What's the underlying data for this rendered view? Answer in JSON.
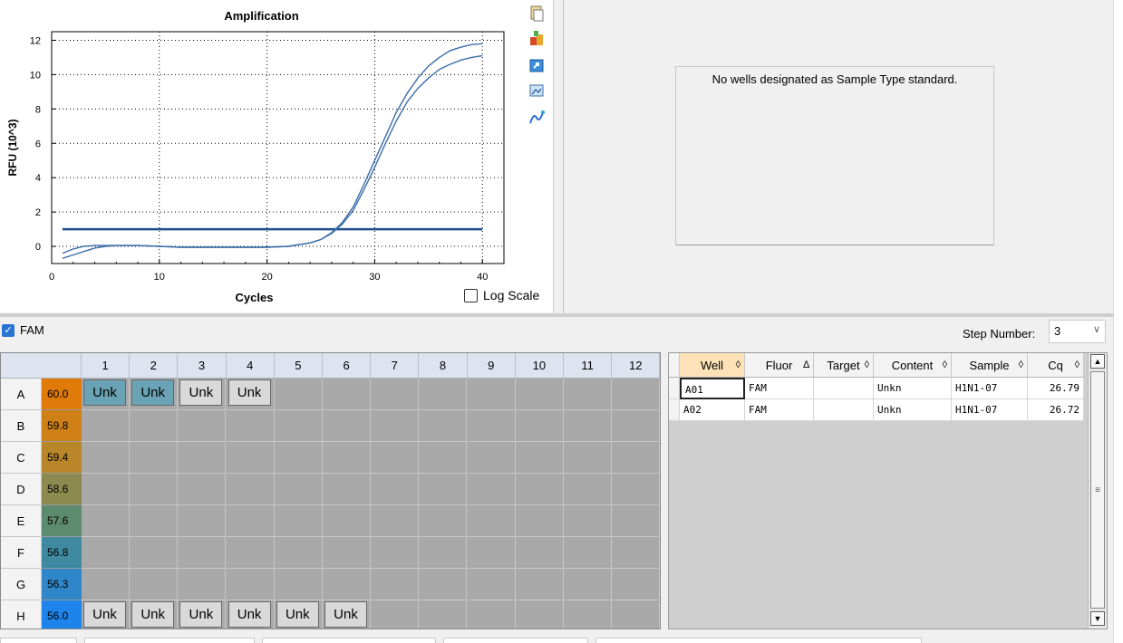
{
  "chart_data": {
    "type": "line",
    "title": "Amplification",
    "xlabel": "Cycles",
    "ylabel": "RFU (10^3)",
    "xlim": [
      0,
      42
    ],
    "ylim": [
      -1,
      12.5
    ],
    "xticks": [
      0,
      10,
      20,
      30,
      40
    ],
    "yticks": [
      0,
      2,
      4,
      6,
      8,
      10,
      12
    ],
    "grid": true,
    "threshold": 1.0,
    "series": [
      {
        "color": "#3d6ea8",
        "x": [
          1,
          2,
          3,
          4,
          5,
          6,
          8,
          10,
          12,
          14,
          16,
          18,
          20,
          22,
          23,
          24,
          25,
          26,
          27,
          28,
          29,
          30,
          31,
          32,
          33,
          34,
          35,
          36,
          37,
          38,
          39,
          40
        ],
        "y": [
          -0.7,
          -0.5,
          -0.3,
          -0.1,
          0,
          0.05,
          0.05,
          0,
          -0.05,
          -0.05,
          -0.05,
          -0.05,
          -0.05,
          0,
          0.1,
          0.2,
          0.4,
          0.8,
          1.4,
          2.3,
          3.6,
          5.0,
          6.4,
          7.8,
          8.9,
          9.8,
          10.5,
          11.0,
          11.4,
          11.6,
          11.75,
          11.8
        ]
      },
      {
        "color": "#3d6ea8",
        "x": [
          1,
          2,
          3,
          4,
          5,
          6,
          8,
          10,
          12,
          14,
          16,
          18,
          20,
          22,
          23,
          24,
          25,
          26,
          27,
          28,
          29,
          30,
          31,
          32,
          33,
          34,
          35,
          36,
          37,
          38,
          39,
          40
        ],
        "y": [
          -0.4,
          -0.15,
          0,
          0.05,
          0.05,
          0.05,
          0.05,
          0,
          -0.05,
          -0.05,
          -0.05,
          -0.05,
          -0.05,
          0,
          0.1,
          0.2,
          0.4,
          0.75,
          1.3,
          2.1,
          3.3,
          4.6,
          6.0,
          7.3,
          8.4,
          9.2,
          9.8,
          10.3,
          10.6,
          10.85,
          11.0,
          11.1
        ]
      }
    ]
  },
  "log_scale_label": "Log Scale",
  "tools": [
    "copy-icon",
    "export-icon",
    "refresh-icon",
    "image-icon",
    "line-settings-icon"
  ],
  "std_message": "No wells designated as Sample Type standard.",
  "fluor_label": "FAM",
  "step_label": "Step Number:",
  "step_value": "3",
  "plate": {
    "cols": [
      "1",
      "2",
      "3",
      "4",
      "5",
      "6",
      "7",
      "8",
      "9",
      "10",
      "11",
      "12"
    ],
    "rows": [
      "A",
      "B",
      "C",
      "D",
      "E",
      "F",
      "G",
      "H"
    ],
    "temps": [
      "60.0",
      "59.8",
      "59.4",
      "58.6",
      "57.6",
      "56.8",
      "56.3",
      "56.0"
    ],
    "temp_colors": [
      "#e07a08",
      "#cf8016",
      "#b9862a",
      "#8c8a4e",
      "#5e8a6e",
      "#3f8aa0",
      "#2f86c8",
      "#1d84ec"
    ],
    "wells": [
      {
        "row": 0,
        "col": 0,
        "label": "Unk",
        "style": "sel"
      },
      {
        "row": 0,
        "col": 1,
        "label": "Unk",
        "style": "sel"
      },
      {
        "row": 0,
        "col": 2,
        "label": "Unk",
        "style": "plain"
      },
      {
        "row": 0,
        "col": 3,
        "label": "Unk",
        "style": "plain"
      },
      {
        "row": 7,
        "col": 0,
        "label": "Unk",
        "style": "plain"
      },
      {
        "row": 7,
        "col": 1,
        "label": "Unk",
        "style": "plain"
      },
      {
        "row": 7,
        "col": 2,
        "label": "Unk",
        "style": "plain"
      },
      {
        "row": 7,
        "col": 3,
        "label": "Unk",
        "style": "plain"
      },
      {
        "row": 7,
        "col": 4,
        "label": "Unk",
        "style": "plain"
      },
      {
        "row": 7,
        "col": 5,
        "label": "Unk",
        "style": "plain"
      }
    ]
  },
  "table": {
    "columns": [
      {
        "label": "Well",
        "sort": "◊"
      },
      {
        "label": "Fluor",
        "sort": "∆"
      },
      {
        "label": "Target",
        "sort": "◊"
      },
      {
        "label": "Content",
        "sort": "◊"
      },
      {
        "label": "Sample",
        "sort": "◊"
      },
      {
        "label": "Cq",
        "sort": "◊"
      }
    ],
    "rows": [
      [
        "A01",
        "FAM",
        "",
        "Unkn",
        "H1N1-07",
        "26.79"
      ],
      [
        "A02",
        "FAM",
        "",
        "Unkn",
        "H1N1-07",
        "26.72"
      ]
    ]
  }
}
